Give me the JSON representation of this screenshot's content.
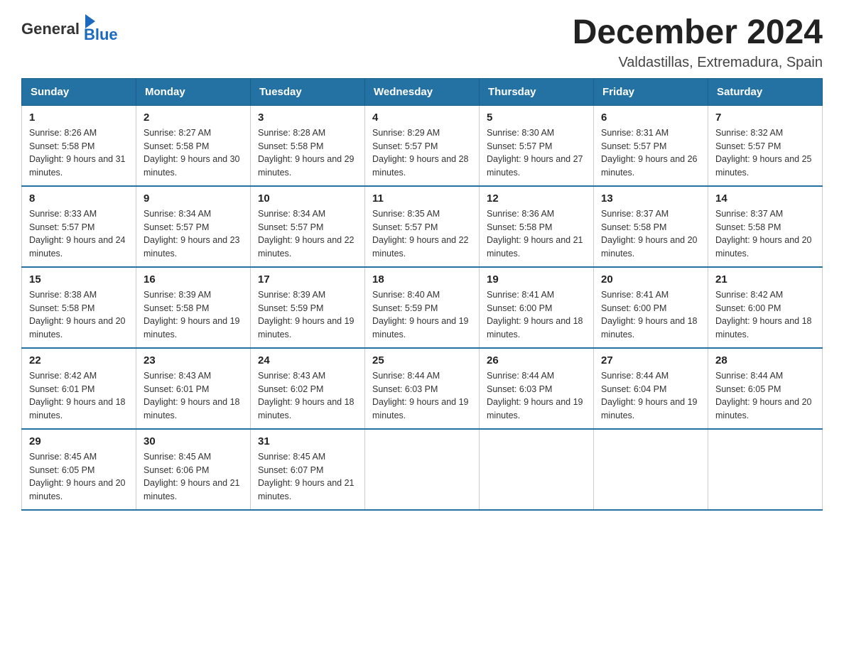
{
  "header": {
    "logo": {
      "text_general": "General",
      "text_blue": "Blue",
      "alt": "GeneralBlue logo"
    },
    "title": "December 2024",
    "location": "Valdastillas, Extremadura, Spain"
  },
  "weekdays": [
    "Sunday",
    "Monday",
    "Tuesday",
    "Wednesday",
    "Thursday",
    "Friday",
    "Saturday"
  ],
  "weeks": [
    [
      {
        "day": "1",
        "sunrise": "8:26 AM",
        "sunset": "5:58 PM",
        "daylight": "9 hours and 31 minutes."
      },
      {
        "day": "2",
        "sunrise": "8:27 AM",
        "sunset": "5:58 PM",
        "daylight": "9 hours and 30 minutes."
      },
      {
        "day": "3",
        "sunrise": "8:28 AM",
        "sunset": "5:58 PM",
        "daylight": "9 hours and 29 minutes."
      },
      {
        "day": "4",
        "sunrise": "8:29 AM",
        "sunset": "5:57 PM",
        "daylight": "9 hours and 28 minutes."
      },
      {
        "day": "5",
        "sunrise": "8:30 AM",
        "sunset": "5:57 PM",
        "daylight": "9 hours and 27 minutes."
      },
      {
        "day": "6",
        "sunrise": "8:31 AM",
        "sunset": "5:57 PM",
        "daylight": "9 hours and 26 minutes."
      },
      {
        "day": "7",
        "sunrise": "8:32 AM",
        "sunset": "5:57 PM",
        "daylight": "9 hours and 25 minutes."
      }
    ],
    [
      {
        "day": "8",
        "sunrise": "8:33 AM",
        "sunset": "5:57 PM",
        "daylight": "9 hours and 24 minutes."
      },
      {
        "day": "9",
        "sunrise": "8:34 AM",
        "sunset": "5:57 PM",
        "daylight": "9 hours and 23 minutes."
      },
      {
        "day": "10",
        "sunrise": "8:34 AM",
        "sunset": "5:57 PM",
        "daylight": "9 hours and 22 minutes."
      },
      {
        "day": "11",
        "sunrise": "8:35 AM",
        "sunset": "5:57 PM",
        "daylight": "9 hours and 22 minutes."
      },
      {
        "day": "12",
        "sunrise": "8:36 AM",
        "sunset": "5:58 PM",
        "daylight": "9 hours and 21 minutes."
      },
      {
        "day": "13",
        "sunrise": "8:37 AM",
        "sunset": "5:58 PM",
        "daylight": "9 hours and 20 minutes."
      },
      {
        "day": "14",
        "sunrise": "8:37 AM",
        "sunset": "5:58 PM",
        "daylight": "9 hours and 20 minutes."
      }
    ],
    [
      {
        "day": "15",
        "sunrise": "8:38 AM",
        "sunset": "5:58 PM",
        "daylight": "9 hours and 20 minutes."
      },
      {
        "day": "16",
        "sunrise": "8:39 AM",
        "sunset": "5:58 PM",
        "daylight": "9 hours and 19 minutes."
      },
      {
        "day": "17",
        "sunrise": "8:39 AM",
        "sunset": "5:59 PM",
        "daylight": "9 hours and 19 minutes."
      },
      {
        "day": "18",
        "sunrise": "8:40 AM",
        "sunset": "5:59 PM",
        "daylight": "9 hours and 19 minutes."
      },
      {
        "day": "19",
        "sunrise": "8:41 AM",
        "sunset": "6:00 PM",
        "daylight": "9 hours and 18 minutes."
      },
      {
        "day": "20",
        "sunrise": "8:41 AM",
        "sunset": "6:00 PM",
        "daylight": "9 hours and 18 minutes."
      },
      {
        "day": "21",
        "sunrise": "8:42 AM",
        "sunset": "6:00 PM",
        "daylight": "9 hours and 18 minutes."
      }
    ],
    [
      {
        "day": "22",
        "sunrise": "8:42 AM",
        "sunset": "6:01 PM",
        "daylight": "9 hours and 18 minutes."
      },
      {
        "day": "23",
        "sunrise": "8:43 AM",
        "sunset": "6:01 PM",
        "daylight": "9 hours and 18 minutes."
      },
      {
        "day": "24",
        "sunrise": "8:43 AM",
        "sunset": "6:02 PM",
        "daylight": "9 hours and 18 minutes."
      },
      {
        "day": "25",
        "sunrise": "8:44 AM",
        "sunset": "6:03 PM",
        "daylight": "9 hours and 19 minutes."
      },
      {
        "day": "26",
        "sunrise": "8:44 AM",
        "sunset": "6:03 PM",
        "daylight": "9 hours and 19 minutes."
      },
      {
        "day": "27",
        "sunrise": "8:44 AM",
        "sunset": "6:04 PM",
        "daylight": "9 hours and 19 minutes."
      },
      {
        "day": "28",
        "sunrise": "8:44 AM",
        "sunset": "6:05 PM",
        "daylight": "9 hours and 20 minutes."
      }
    ],
    [
      {
        "day": "29",
        "sunrise": "8:45 AM",
        "sunset": "6:05 PM",
        "daylight": "9 hours and 20 minutes."
      },
      {
        "day": "30",
        "sunrise": "8:45 AM",
        "sunset": "6:06 PM",
        "daylight": "9 hours and 21 minutes."
      },
      {
        "day": "31",
        "sunrise": "8:45 AM",
        "sunset": "6:07 PM",
        "daylight": "9 hours and 21 minutes."
      },
      null,
      null,
      null,
      null
    ]
  ]
}
